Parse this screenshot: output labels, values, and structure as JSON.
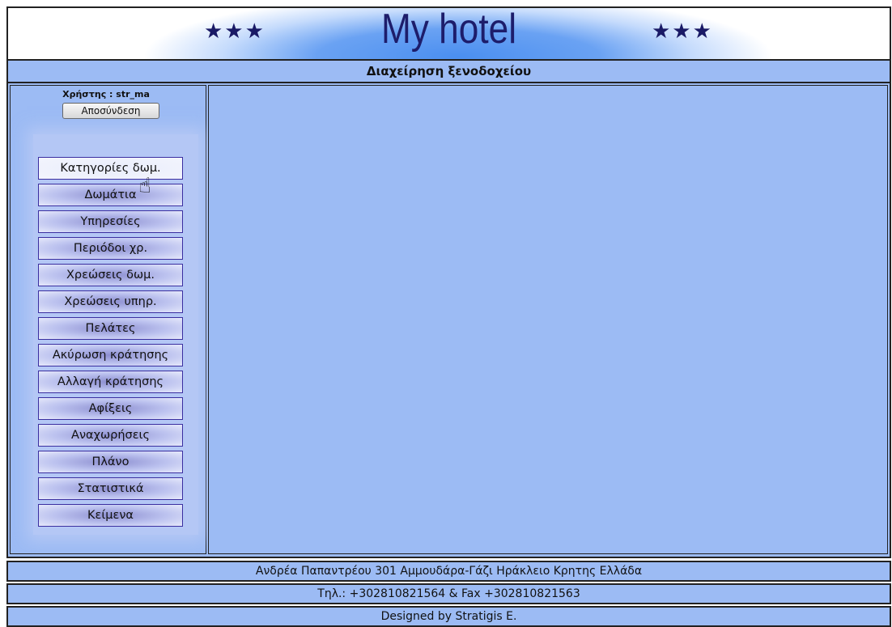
{
  "header": {
    "stars_left": "★★★",
    "title": "My hotel",
    "stars_right": "★★★"
  },
  "subtitle": "Διαχείρηση ξενοδοχείου",
  "sidebar": {
    "user_label": "Χρήστης : str_ma",
    "logout_label": "Αποσύνδεση",
    "menu": [
      {
        "label": "Κατηγορίες δωμ.",
        "active": true
      },
      {
        "label": "Δωμάτια"
      },
      {
        "label": "Υπηρεσίες"
      },
      {
        "label": "Περιόδοι χρ."
      },
      {
        "label": "Χρεώσεις δωμ."
      },
      {
        "label": "Χρεώσεις υπηρ."
      },
      {
        "label": "Πελάτες"
      },
      {
        "label": "Ακύρωση κράτησης"
      },
      {
        "label": "Αλλαγή κράτησης"
      },
      {
        "label": "Αφίξεις"
      },
      {
        "label": "Αναχωρήσεις"
      },
      {
        "label": "Πλάνο"
      },
      {
        "label": "Στατιστικά"
      },
      {
        "label": "Κείμενα"
      }
    ]
  },
  "footer": {
    "address": "Ανδρέα Παπαντρέου 301 Αμμουδάρα-Γάζι Ηράκλειο Κρητης Ελλάδα",
    "phone": "Τηλ.: +302810821564 & Fax +302810821563",
    "credit": "Designed by Stratigis E."
  },
  "colors": {
    "panel": "#9cbbf4",
    "banner_blue": "#4b8ff0",
    "title_navy": "#1d1d6b"
  }
}
